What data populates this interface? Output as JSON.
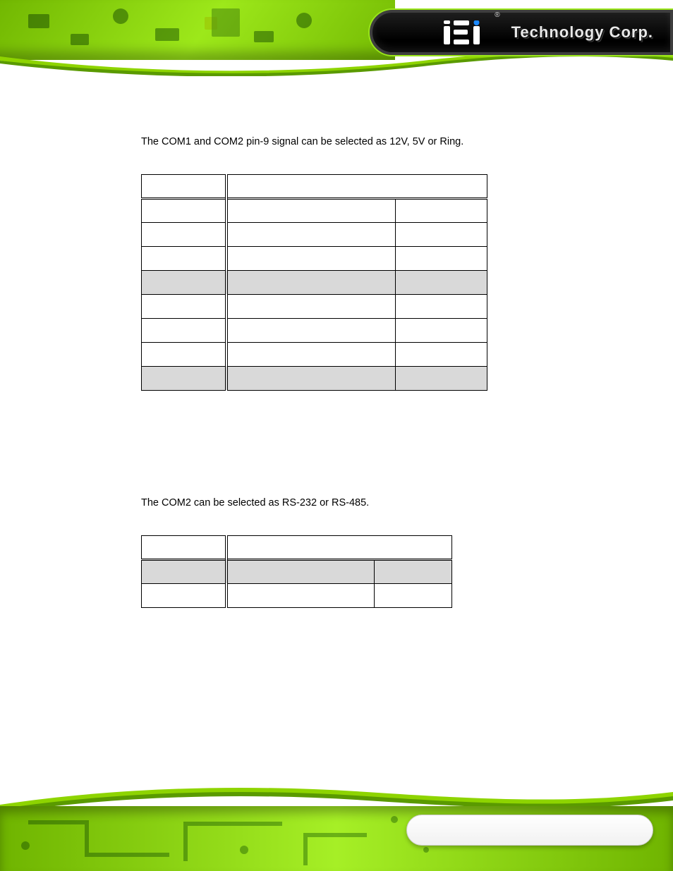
{
  "header": {
    "brand_text": "Technology Corp.",
    "logo_label": "iEi"
  },
  "section1": {
    "intro": "The COM1 and COM2 pin-9 signal can be selected as 12V, 5V or Ring.",
    "table": {
      "headers": [
        "",
        ""
      ],
      "rows": [
        {
          "shaded": false,
          "cells": [
            "",
            "",
            ""
          ]
        },
        {
          "shaded": false,
          "cells": [
            "",
            "",
            ""
          ]
        },
        {
          "shaded": false,
          "cells": [
            "",
            "",
            ""
          ]
        },
        {
          "shaded": true,
          "cells": [
            "",
            "",
            ""
          ]
        },
        {
          "shaded": false,
          "cells": [
            "",
            "",
            ""
          ]
        },
        {
          "shaded": false,
          "cells": [
            "",
            "",
            ""
          ]
        },
        {
          "shaded": false,
          "cells": [
            "",
            "",
            ""
          ]
        },
        {
          "shaded": true,
          "cells": [
            "",
            "",
            ""
          ]
        }
      ]
    }
  },
  "section2": {
    "intro": "The COM2 can be selected as RS-232 or RS-485.",
    "table": {
      "headers": [
        "",
        ""
      ],
      "rows": [
        {
          "shaded": true,
          "cells": [
            "",
            "",
            ""
          ]
        },
        {
          "shaded": false,
          "cells": [
            "",
            "",
            ""
          ]
        }
      ]
    }
  }
}
